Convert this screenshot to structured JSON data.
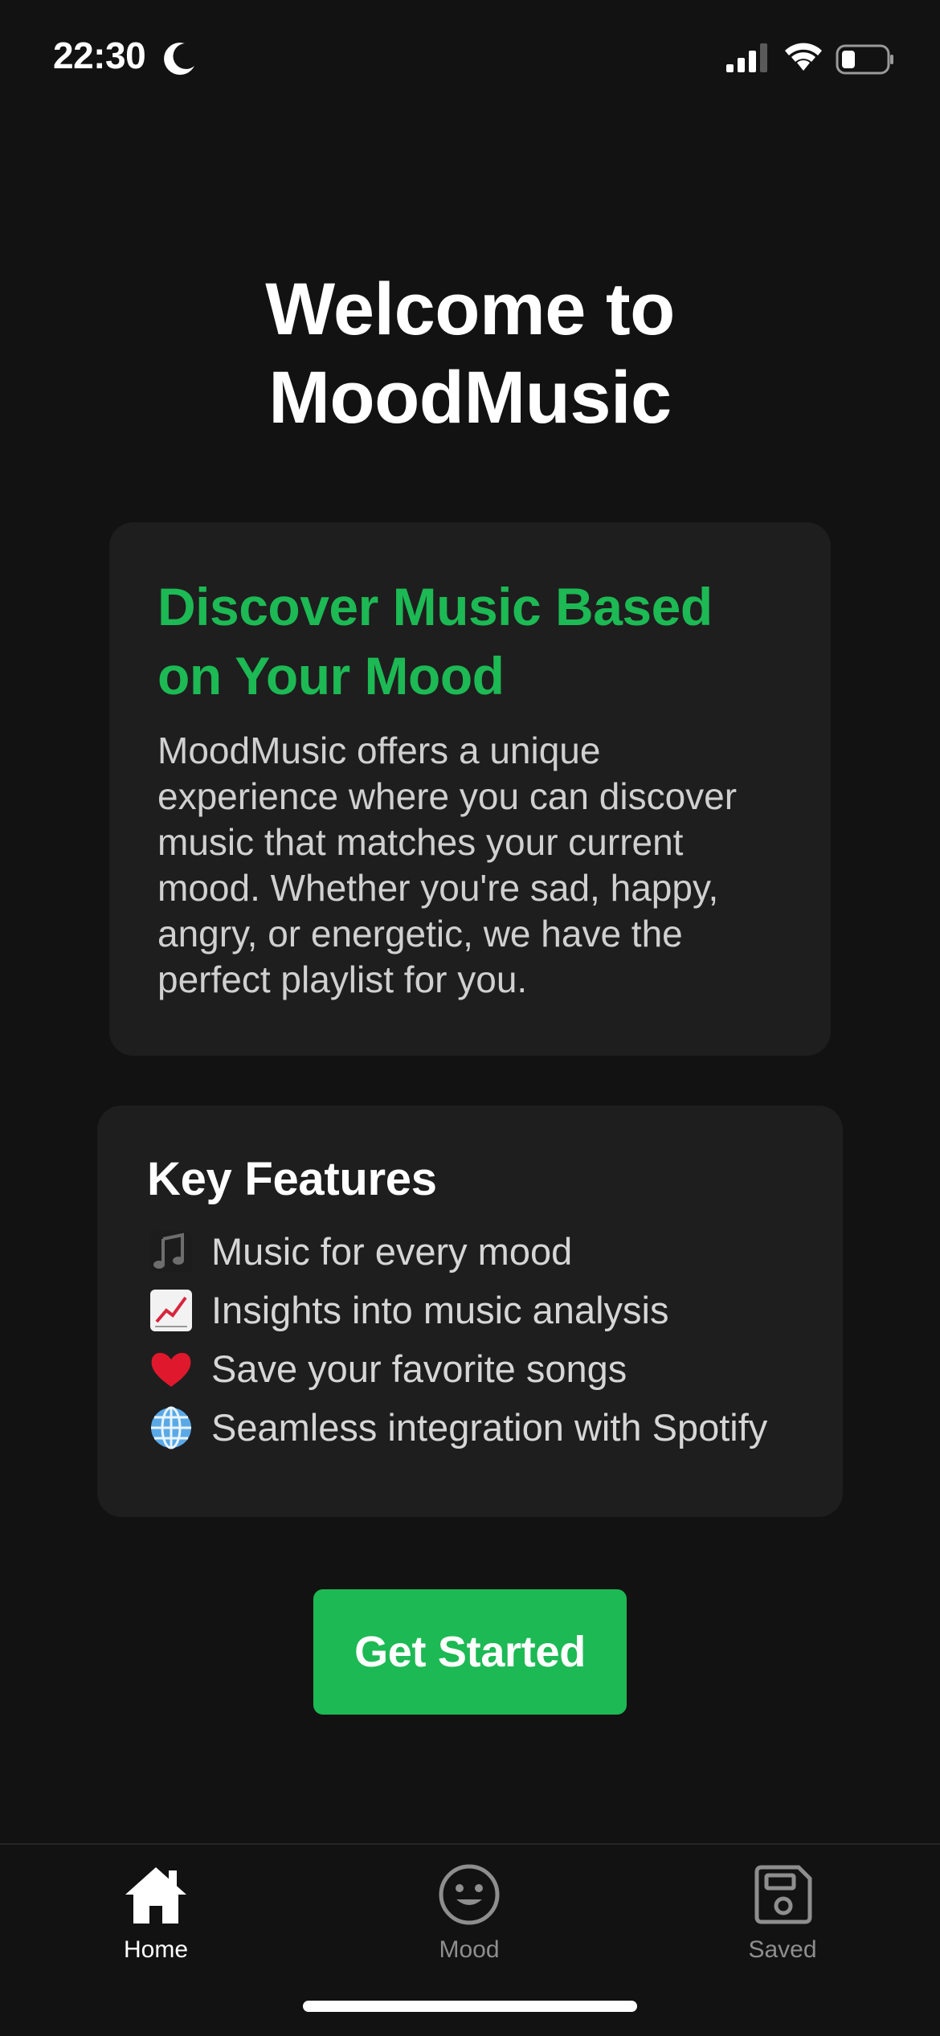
{
  "status_bar": {
    "time": "22:30",
    "icons": [
      "moon-icon",
      "signal-icon",
      "wifi-icon",
      "battery-icon"
    ]
  },
  "hero": {
    "title_line1": "Welcome to",
    "title_line2": "MoodMusic"
  },
  "intro_card": {
    "title": "Discover Music Based on Your Mood",
    "text": "MoodMusic offers a unique experience where you can discover music that matches your current mood. Whether you're sad, happy, angry, or energetic, we have the perfect playlist for you."
  },
  "features_card": {
    "heading": "Key Features",
    "items": [
      {
        "icon": "musical-notes-icon",
        "label": "Music for every mood"
      },
      {
        "icon": "chart-increasing-icon",
        "label": "Insights into music analysis"
      },
      {
        "icon": "red-heart-icon",
        "label": "Save your favorite songs"
      },
      {
        "icon": "globe-icon",
        "label": "Seamless integration with Spotify"
      }
    ]
  },
  "cta": {
    "label": "Get Started"
  },
  "tab_bar": {
    "tabs": [
      {
        "icon": "home-icon",
        "label": "Home",
        "active": true
      },
      {
        "icon": "smiley-icon",
        "label": "Mood",
        "active": false
      },
      {
        "icon": "save-icon",
        "label": "Saved",
        "active": false
      }
    ]
  },
  "colors": {
    "background": "#121212",
    "card": "#1e1e1e",
    "accent": "#1db954",
    "inactive_tab": "#8e8e8e"
  }
}
